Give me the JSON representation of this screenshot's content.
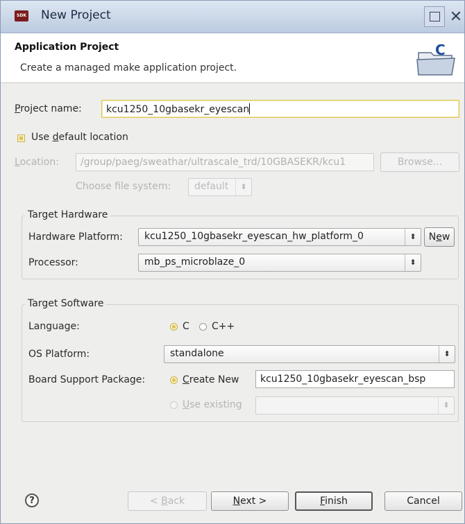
{
  "window": {
    "title": "New Project",
    "icon_name": "sdk-app-icon"
  },
  "banner": {
    "title": "Application Project",
    "description": "Create a managed make application project.",
    "icon_name": "c-project-folder-icon"
  },
  "project": {
    "name_label_u": "P",
    "name_label_rest": "roject name:",
    "name_value": "kcu1250_10gbasekr_eyescan"
  },
  "location": {
    "use_default_pre": "Use ",
    "use_default_u": "d",
    "use_default_post": "efault location",
    "use_default_checked": true,
    "label_u": "L",
    "label_rest": "ocation:",
    "value": "/group/paeg/sweathar/ultrascale_trd/10GBASEKR/kcu1",
    "browse_label": "Browse...",
    "fs_label": "Choose file system:",
    "fs_value": "default"
  },
  "target_hardware": {
    "title": "Target Hardware",
    "platform_label": "Hardware Platform:",
    "platform_value": "kcu1250_10gbasekr_eyescan_hw_platform_0",
    "new_button": "New",
    "new_button_u": "e",
    "processor_label": "Processor:",
    "processor_value": "mb_ps_microblaze_0"
  },
  "target_software": {
    "title": "Target Software",
    "language_label": "Language:",
    "lang_c": "C",
    "lang_cpp": "C++",
    "selected_language": "C",
    "os_label": "OS Platform:",
    "os_value": "standalone",
    "bsp_label": "Board Support Package:",
    "create_new_u": "C",
    "create_new_rest": "reate New",
    "bsp_value": "kcu1250_10gbasekr_eyescan_bsp",
    "use_existing_u": "U",
    "use_existing_rest": "se existing"
  },
  "footer": {
    "back_lt": "< ",
    "back_u": "B",
    "back_rest": "ack",
    "next_u": "N",
    "next_rest": "ext >",
    "finish_u": "F",
    "finish_rest": "inish",
    "cancel": "Cancel",
    "help_icon": "help-icon",
    "help_glyph": "?"
  },
  "colors": {
    "titlebar": "#c6d3e6",
    "dialog_bg": "#eeeeec",
    "accent_yellow": "#d9c35a"
  }
}
